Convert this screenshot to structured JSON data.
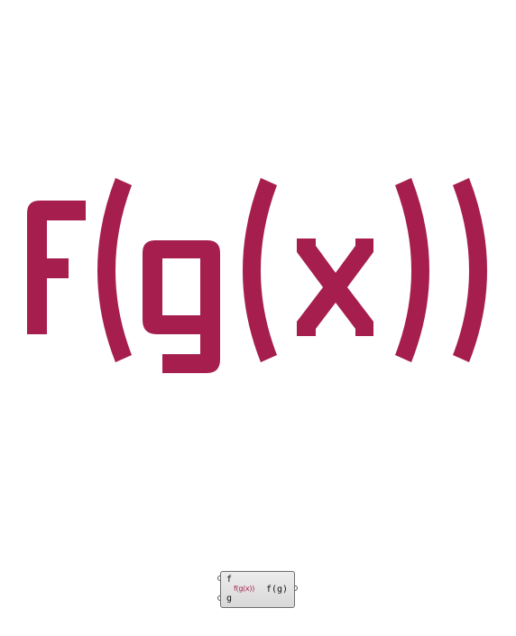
{
  "canvas": {
    "background": "#ffffff"
  },
  "hero": {
    "label": "f(g(x))",
    "color": "#A61E4D",
    "glyphs": [
      "f",
      "(",
      "g",
      "(",
      "x",
      ")",
      ")"
    ]
  },
  "component": {
    "input_f": "f",
    "input_g": "g",
    "logo": "f(g(x))",
    "output": "f(g)",
    "border_color": "#6e6e6e",
    "fill_color": "#e2e2e2"
  }
}
